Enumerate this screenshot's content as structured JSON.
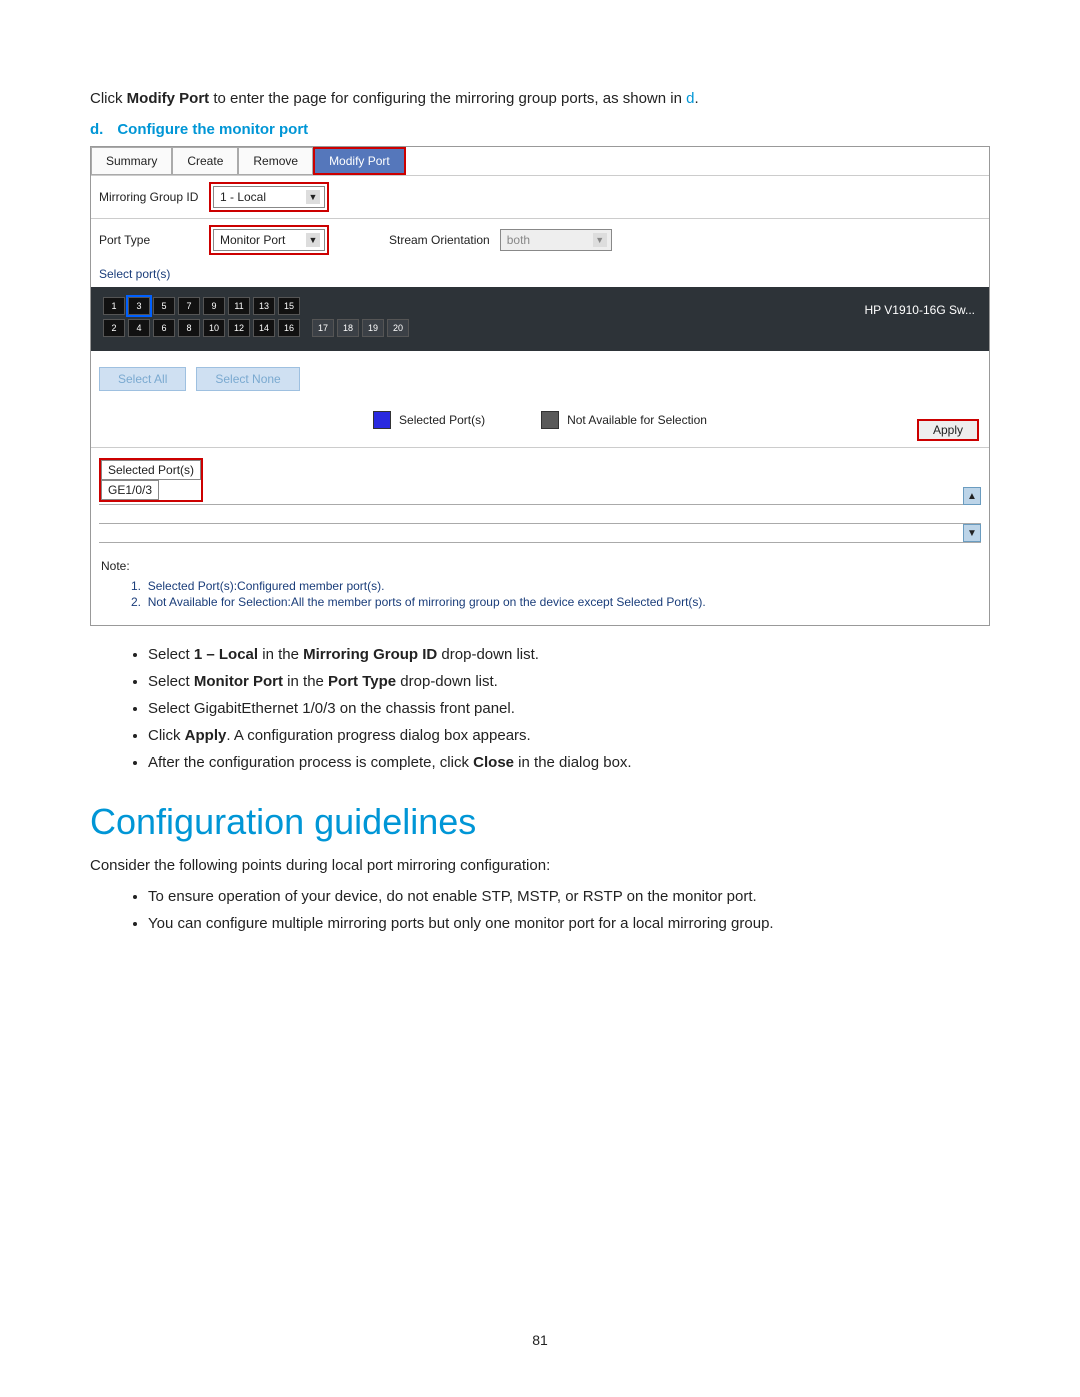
{
  "intro": {
    "prefix": "Click ",
    "bold1": "Modify Port",
    "middle": " to enter the page for configuring the mirroring group ports, as shown in ",
    "link": "d",
    "suffix": "."
  },
  "step": {
    "letter": "d.",
    "title": "Configure the monitor port"
  },
  "ui": {
    "tabs": [
      "Summary",
      "Create",
      "Remove",
      "Modify Port"
    ],
    "mirroringLabel": "Mirroring Group ID",
    "mirroringValue": "1 - Local",
    "portTypeLabel": "Port Type",
    "portTypeValue": "Monitor Port",
    "streamLabel": "Stream Orientation",
    "streamValue": "both",
    "selectPorts": "Select port(s)",
    "topPorts": [
      "1",
      "3",
      "5",
      "7",
      "9",
      "11",
      "13",
      "15"
    ],
    "bottomPorts": [
      "2",
      "4",
      "6",
      "8",
      "10",
      "12",
      "14",
      "16"
    ],
    "extraPorts": [
      "17",
      "18",
      "19",
      "20"
    ],
    "device": "HP V1910-16G Sw...",
    "selectAll": "Select All",
    "selectNone": "Select None",
    "selectedLegend": "Selected Port(s)",
    "naLegend": "Not Available for Selection",
    "apply": "Apply",
    "selPortsHeader": "Selected Port(s)",
    "selPortsValue": "GE1/0/3",
    "noteLabel": "Note:",
    "note1_num": "1.",
    "note1_text": "Selected Port(s):Configured member port(s).",
    "note2_num": "2.",
    "note2_text": "Not Available for Selection:All the member ports of mirroring group on the device except Selected Port(s)."
  },
  "bullets": [
    {
      "pre": "Select ",
      "b1": "1 – Local",
      "mid": " in the ",
      "b2": "Mirroring Group ID",
      "post": " drop-down list."
    },
    {
      "pre": "Select ",
      "b1": "Monitor Port",
      "mid": " in the ",
      "b2": "Port Type",
      "post": " drop-down list."
    },
    {
      "plain": "Select GigabitEthernet 1/0/3 on the chassis front panel."
    },
    {
      "pre": "Click ",
      "b1": "Apply",
      "post": ". A configuration progress dialog box appears."
    },
    {
      "pre": "After the configuration process is complete, click ",
      "b1": "Close",
      "post": " in the dialog box."
    }
  ],
  "guidelinesHeading": "Configuration guidelines",
  "guidelinesIntro": "Consider the following points during local port mirroring configuration:",
  "guidelines": [
    "To ensure operation of your device, do not enable STP, MSTP, or RSTP on the monitor port.",
    "You can configure multiple mirroring ports but only one monitor port for a local mirroring group."
  ],
  "pageNumber": "81"
}
